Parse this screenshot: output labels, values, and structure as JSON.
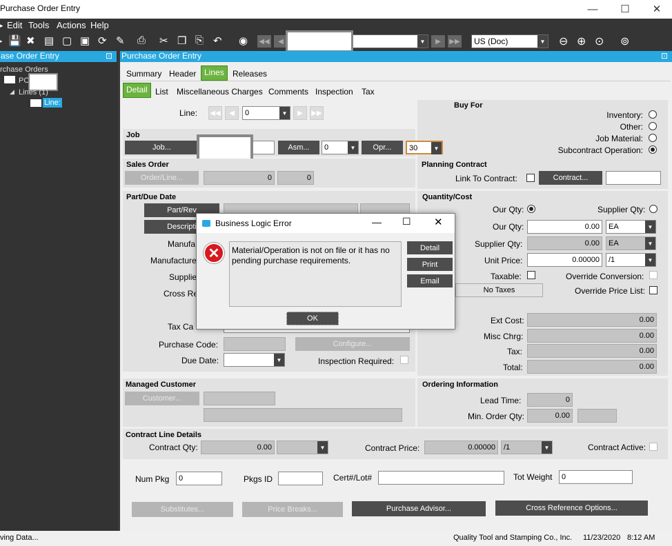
{
  "window": {
    "title": "Purchase Order Entry"
  },
  "menu": [
    "Edit",
    "Tools",
    "Actions",
    "Help"
  ],
  "toolbar": {
    "currency": "US (Doc)"
  },
  "left_panel": {
    "header": "ase Order Entry",
    "tree_root": "rchase Orders",
    "tree_po": "PO",
    "tree_lines": "Lines (1)",
    "tree_line": "Line:"
  },
  "main_header": "Purchase Order Entry",
  "tabs": [
    "Summary",
    "Header",
    "Lines",
    "Releases"
  ],
  "subtabs": [
    "Detail",
    "List",
    "Miscellaneous Charges",
    "Comments",
    "Inspection",
    "Tax"
  ],
  "line": {
    "label": "Line:",
    "value": "0"
  },
  "buy_for": {
    "title": "Buy For",
    "options": [
      "Inventory:",
      "Other:",
      "Job Material:",
      "Subcontract Operation:"
    ],
    "selected_index": 3
  },
  "job": {
    "title": "Job",
    "job_btn": "Job...",
    "asm_btn": "Asm...",
    "asm_val": "0",
    "opr_btn": "Opr...",
    "opr_val": "30"
  },
  "sales_order": {
    "title": "Sales Order",
    "btn": "Order/Line...",
    "val1": "0",
    "val2": "0"
  },
  "planning": {
    "title": "Planning Contract",
    "link_label": "Link To Contract:",
    "btn": "Contract..."
  },
  "part": {
    "title": "Part/Due Date",
    "partrev_btn": "Part/Rev",
    "desc_btn": "Descripti",
    "manuf": "Manufa",
    "manufacturer": "Manufacture",
    "supplier": "Supplie",
    "cross": "Cross Re",
    "tax_cat": "Tax Ca",
    "purchase_code": "Purchase Code:",
    "configure": "Configure...",
    "due_date": "Due Date:",
    "inspection": "Inspection Required:"
  },
  "qty": {
    "title": "Quantity/Cost",
    "our_qty_radio": "Our Qty:",
    "supplier_qty_radio": "Supplier Qty:",
    "our_qty": "Our Qty:",
    "our_qty_val": "0.00",
    "our_uom": "EA",
    "supplier_qty": "Supplier Qty:",
    "supplier_qty_val": "0.00",
    "supplier_uom": "EA",
    "unit_price": "Unit Price:",
    "unit_price_val": "0.00000",
    "price_per": "/1",
    "taxable": "Taxable:",
    "override_conv": "Override Conversion:",
    "no_taxes": "No Taxes",
    "override_price": "Override Price List:",
    "ext_cost": "Ext Cost:",
    "ext_cost_val": "0.00",
    "misc": "Misc Chrg:",
    "misc_val": "0.00",
    "tax": "Tax:",
    "tax_val": "0.00",
    "total": "Total:",
    "total_val": "0.00"
  },
  "managed": {
    "title": "Managed Customer",
    "btn": "Customer..."
  },
  "ordering": {
    "title": "Ordering Information",
    "lead": "Lead Time:",
    "lead_val": "0",
    "min_qty": "Min. Order Qty:",
    "min_qty_val": "0.00"
  },
  "contract_line": {
    "title": "Contract Line Details",
    "qty": "Contract Qty:",
    "qty_val": "0.00",
    "price": "Contract Price:",
    "price_val": "0.00000",
    "price_per": "/1",
    "active": "Contract Active:"
  },
  "bottom": {
    "num_pkg": "Num Pkg",
    "num_pkg_val": "0",
    "pkgs_id": "Pkgs ID",
    "cert": "Cert#/Lot#",
    "tot_weight": "Tot Weight",
    "tot_weight_val": "0",
    "substitutes": "Substitutes...",
    "price_breaks": "Price Breaks...",
    "advisor": "Purchase Advisor...",
    "cross_ref": "Cross Reference Options..."
  },
  "dialog": {
    "title": "Business Logic Error",
    "message": "Material/Operation is not on file or it has no pending purchase requirements.",
    "detail": "Detail",
    "print": "Print",
    "email": "Email",
    "ok": "OK"
  },
  "status": {
    "left": "ving Data...",
    "company": "Quality Tool and Stamping Co., Inc.",
    "date": "11/23/2020",
    "time": "8:12 AM"
  }
}
